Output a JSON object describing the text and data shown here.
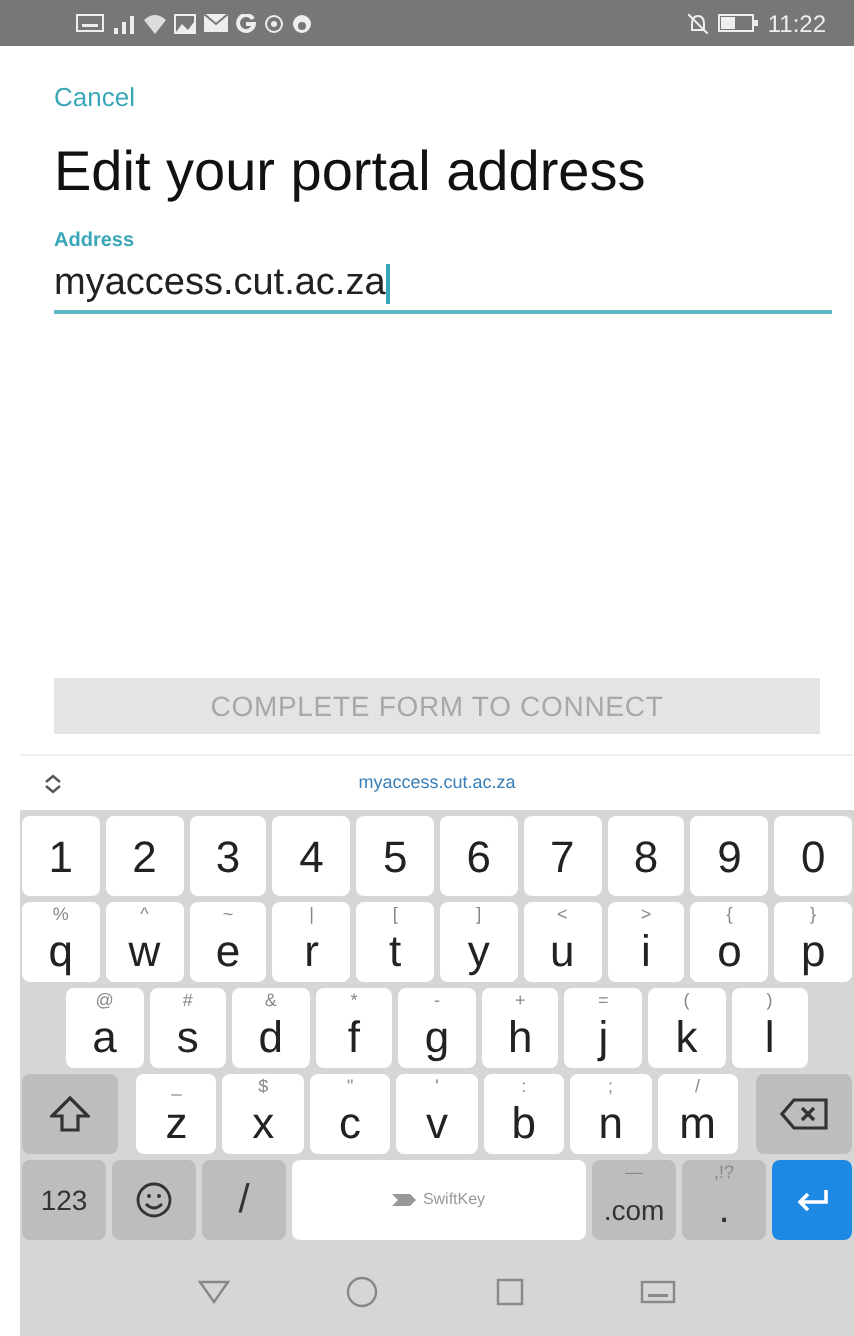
{
  "status_bar": {
    "time": "11:22"
  },
  "cancel": "Cancel",
  "title": "Edit your portal address",
  "address_field": {
    "label": "Address",
    "value": "myaccess.cut.ac.za"
  },
  "connect_button": {
    "label": "COMPLETE FORM TO CONNECT",
    "disabled": true
  },
  "suggestion_bar": {
    "suggestion": "myaccess.cut.ac.za"
  },
  "keyboard": {
    "number_row": [
      {
        "kind": "letter",
        "label": "1"
      },
      {
        "kind": "letter",
        "label": "2"
      },
      {
        "kind": "letter",
        "label": "3"
      },
      {
        "kind": "letter",
        "label": "4"
      },
      {
        "kind": "letter",
        "label": "5"
      },
      {
        "kind": "letter",
        "label": "6"
      },
      {
        "kind": "letter",
        "label": "7"
      },
      {
        "kind": "letter",
        "label": "8"
      },
      {
        "kind": "letter",
        "label": "9"
      },
      {
        "kind": "letter",
        "label": "0"
      }
    ],
    "top_row": [
      {
        "kind": "letter",
        "label": "q",
        "hint": "%"
      },
      {
        "kind": "letter",
        "label": "w",
        "hint": "^"
      },
      {
        "kind": "letter",
        "label": "e",
        "hint": "~"
      },
      {
        "kind": "letter",
        "label": "r",
        "hint": "|"
      },
      {
        "kind": "letter",
        "label": "t",
        "hint": "["
      },
      {
        "kind": "letter",
        "label": "y",
        "hint": "]"
      },
      {
        "kind": "letter",
        "label": "u",
        "hint": "<"
      },
      {
        "kind": "letter",
        "label": "i",
        "hint": ">"
      },
      {
        "kind": "letter",
        "label": "o",
        "hint": "{"
      },
      {
        "kind": "letter",
        "label": "p",
        "hint": "}"
      }
    ],
    "middle_row": [
      {
        "kind": "letter",
        "label": "a",
        "hint": "@"
      },
      {
        "kind": "letter",
        "label": "s",
        "hint": "#"
      },
      {
        "kind": "letter",
        "label": "d",
        "hint": "&"
      },
      {
        "kind": "letter",
        "label": "f",
        "hint": "*"
      },
      {
        "kind": "letter",
        "label": "g",
        "hint": "-"
      },
      {
        "kind": "letter",
        "label": "h",
        "hint": "+"
      },
      {
        "kind": "letter",
        "label": "j",
        "hint": "="
      },
      {
        "kind": "letter",
        "label": "k",
        "hint": "("
      },
      {
        "kind": "letter",
        "label": "l",
        "hint": ")"
      }
    ],
    "bottom_row": [
      {
        "kind": "shift"
      },
      {
        "kind": "letter",
        "label": "z",
        "hint": "_"
      },
      {
        "kind": "letter",
        "label": "x",
        "hint": "$"
      },
      {
        "kind": "letter",
        "label": "c",
        "hint": "\""
      },
      {
        "kind": "letter",
        "label": "v",
        "hint": "'"
      },
      {
        "kind": "letter",
        "label": "b",
        "hint": ":"
      },
      {
        "kind": "letter",
        "label": "n",
        "hint": ";"
      },
      {
        "kind": "letter",
        "label": "m",
        "hint": "/"
      },
      {
        "kind": "backspace"
      }
    ],
    "function_row": [
      {
        "kind": "function",
        "label": "123"
      },
      {
        "kind": "emoji"
      },
      {
        "kind": "function",
        "label": "/"
      },
      {
        "kind": "space",
        "label": "SwiftKey"
      },
      {
        "kind": "function",
        "label": ".com",
        "hint": "—"
      },
      {
        "kind": "function",
        "label": ".",
        "hint": ",!?"
      },
      {
        "kind": "enter"
      }
    ]
  }
}
